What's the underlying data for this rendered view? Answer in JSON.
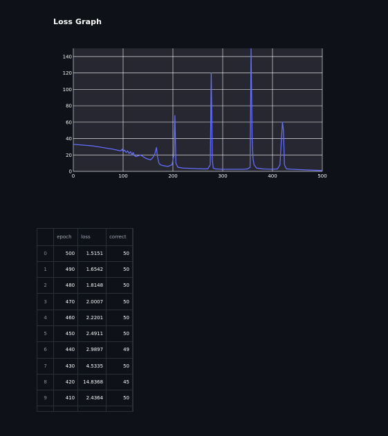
{
  "header": {
    "title": "Loss Graph"
  },
  "chart_data": {
    "type": "line",
    "title": "",
    "xlabel": "",
    "ylabel": "",
    "xlim": [
      0,
      500
    ],
    "ylim": [
      0,
      150
    ],
    "xticks": [
      0,
      100,
      200,
      300,
      400,
      500
    ],
    "yticks": [
      0,
      20,
      40,
      60,
      80,
      100,
      120,
      140
    ],
    "grid": true,
    "colors": {
      "line": "#636efa",
      "plot_bg": "#262730",
      "grid": "#ffffff"
    },
    "series": [
      {
        "x": [
          0,
          20,
          40,
          60,
          80,
          95,
          98,
          100,
          103,
          106,
          109,
          112,
          115,
          118,
          120,
          123,
          126,
          130,
          135,
          140,
          145,
          150,
          155,
          160,
          164,
          167,
          169,
          172,
          175,
          180,
          190,
          198,
          202,
          204,
          206,
          210,
          220,
          240,
          260,
          270,
          275,
          277,
          279,
          281,
          285,
          300,
          320,
          340,
          350,
          355,
          357,
          359,
          361,
          363,
          368,
          380,
          400,
          410,
          415,
          418,
          420,
          422,
          424,
          428,
          440,
          460,
          480,
          500
        ],
        "y": [
          33,
          32,
          31,
          29,
          27,
          25,
          27,
          24,
          26,
          23,
          25,
          22,
          24,
          20,
          23,
          19,
          18,
          19,
          20,
          18,
          16,
          15,
          14,
          17,
          22,
          29,
          18,
          10,
          8,
          7,
          6,
          8,
          20,
          68,
          10,
          5,
          4,
          3.5,
          3,
          3,
          8,
          120,
          15,
          4,
          3,
          2.5,
          2.5,
          2.5,
          3,
          5,
          150,
          40,
          15,
          8,
          4,
          3,
          2.5,
          3,
          8,
          40,
          60,
          50,
          8,
          3,
          2.5,
          2,
          1.5,
          1
        ]
      }
    ]
  },
  "table": {
    "columns": [
      "epoch",
      "loss",
      "correct"
    ],
    "rows": [
      {
        "index": "0",
        "epoch": "500",
        "loss": "1.5151",
        "correct": "50"
      },
      {
        "index": "1",
        "epoch": "490",
        "loss": "1.6542",
        "correct": "50"
      },
      {
        "index": "2",
        "epoch": "480",
        "loss": "1.8148",
        "correct": "50"
      },
      {
        "index": "3",
        "epoch": "470",
        "loss": "2.0007",
        "correct": "50"
      },
      {
        "index": "4",
        "epoch": "460",
        "loss": "2.2201",
        "correct": "50"
      },
      {
        "index": "5",
        "epoch": "450",
        "loss": "2.4911",
        "correct": "50"
      },
      {
        "index": "6",
        "epoch": "440",
        "loss": "2.9897",
        "correct": "49"
      },
      {
        "index": "7",
        "epoch": "430",
        "loss": "4.5335",
        "correct": "50"
      },
      {
        "index": "8",
        "epoch": "420",
        "loss": "14.8368",
        "correct": "45"
      },
      {
        "index": "9",
        "epoch": "410",
        "loss": "2.4364",
        "correct": "50"
      }
    ]
  }
}
